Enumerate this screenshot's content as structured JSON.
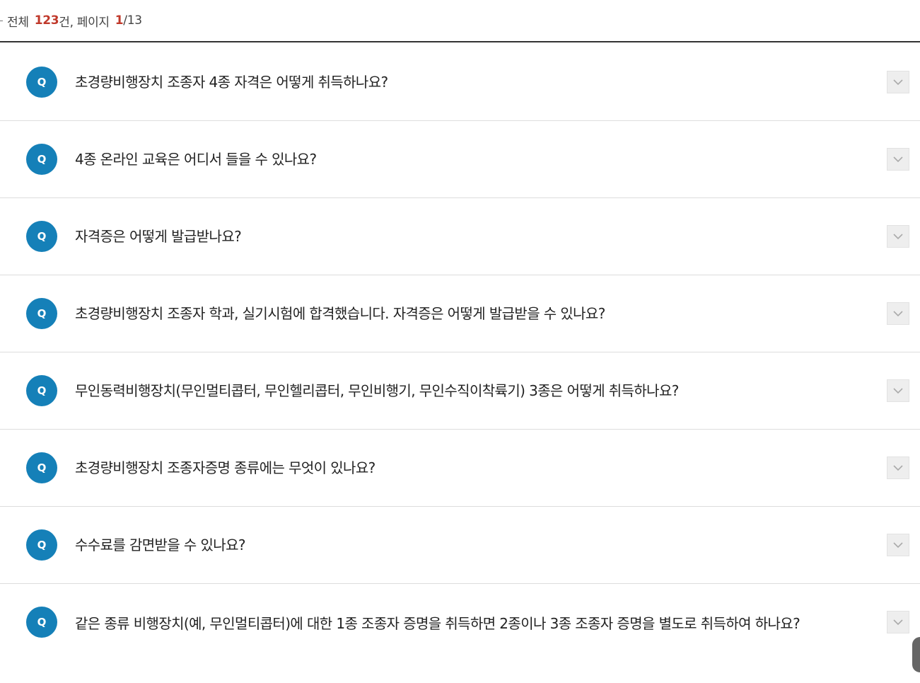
{
  "summary": {
    "total_label": "전체",
    "total_count": "123",
    "count_unit": "건,",
    "page_label": "페이지",
    "current_page": "1",
    "total_pages": "/13"
  },
  "badge_label": "Q",
  "faq": [
    {
      "question": "초경량비행장치 조종자 4종 자격은 어떻게 취득하나요?"
    },
    {
      "question": "4종 온라인 교육은 어디서 들을 수 있나요?"
    },
    {
      "question": "자격증은 어떻게 발급받나요?"
    },
    {
      "question": "초경량비행장치 조종자 학과, 실기시험에 합격했습니다. 자격증은 어떻게 발급받을 수 있나요?"
    },
    {
      "question": "무인동력비행장치(무인멀티콥터, 무인헬리콥터, 무인비행기, 무인수직이착륙기) 3종은 어떻게 취득하나요?"
    },
    {
      "question": "초경량비행장치 조종자증명 종류에는 무엇이 있나요?"
    },
    {
      "question": "수수료를 감면받을 수 있나요?"
    },
    {
      "question": "같은 종류 비행장치(예, 무인멀티콥터)에 대한 1종 조종자 증명을 취득하면 2종이나 3종 조종자 증명을 별도로 취득하여 하나요?"
    }
  ],
  "icons": {
    "toggle": "chevron-down-icon"
  },
  "colors": {
    "badge": "#1580b8",
    "highlight": "#c0392b"
  }
}
